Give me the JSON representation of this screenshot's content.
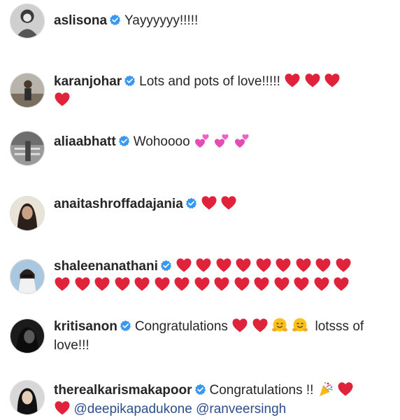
{
  "comments": [
    {
      "username": "aslisona",
      "parts": [
        {
          "t": "text",
          "v": "Yayyyyyy!!!!!"
        }
      ]
    },
    {
      "username": "karanjohar",
      "parts": [
        {
          "t": "text",
          "v": "Lots and pots of love!!!!!"
        },
        {
          "t": "emoji",
          "name": "red-heart-emoji",
          "count": 4
        }
      ]
    },
    {
      "username": "aliaabhatt",
      "parts": [
        {
          "t": "text",
          "v": "Wohoooo"
        },
        {
          "t": "emoji",
          "name": "two-hearts-emoji",
          "count": 3
        }
      ]
    },
    {
      "username": "anaitashroffadajania",
      "parts": [
        {
          "t": "emoji",
          "name": "red-heart-emoji",
          "count": 2
        }
      ]
    },
    {
      "username": "shaleenanathani",
      "parts": [
        {
          "t": "emoji",
          "name": "red-heart-emoji",
          "count": 24
        }
      ]
    },
    {
      "username": "kritisanon",
      "parts": [
        {
          "t": "text",
          "v": "Congratulations"
        },
        {
          "t": "emoji",
          "name": "red-heart-emoji",
          "count": 2
        },
        {
          "t": "emoji",
          "name": "hugging-face-emoji",
          "count": 2
        },
        {
          "t": "text",
          "v": "lotsss of love!!!"
        }
      ]
    },
    {
      "username": "therealkarismakapoor",
      "parts": [
        {
          "t": "text",
          "v": "Congratulations !!"
        },
        {
          "t": "emoji",
          "name": "party-popper-emoji",
          "count": 1
        },
        {
          "t": "emoji",
          "name": "red-heart-emoji",
          "count": 2
        },
        {
          "t": "mention",
          "v": "@deepikapadukone"
        },
        {
          "t": "mention",
          "v": "@ranveersingh"
        }
      ]
    }
  ],
  "colors": {
    "username": "#262626",
    "mention": "#2b4f8a",
    "verified_badge": "#3897f0",
    "heart": "#e0233b"
  },
  "icons": {
    "verified": "verified-badge-icon"
  }
}
